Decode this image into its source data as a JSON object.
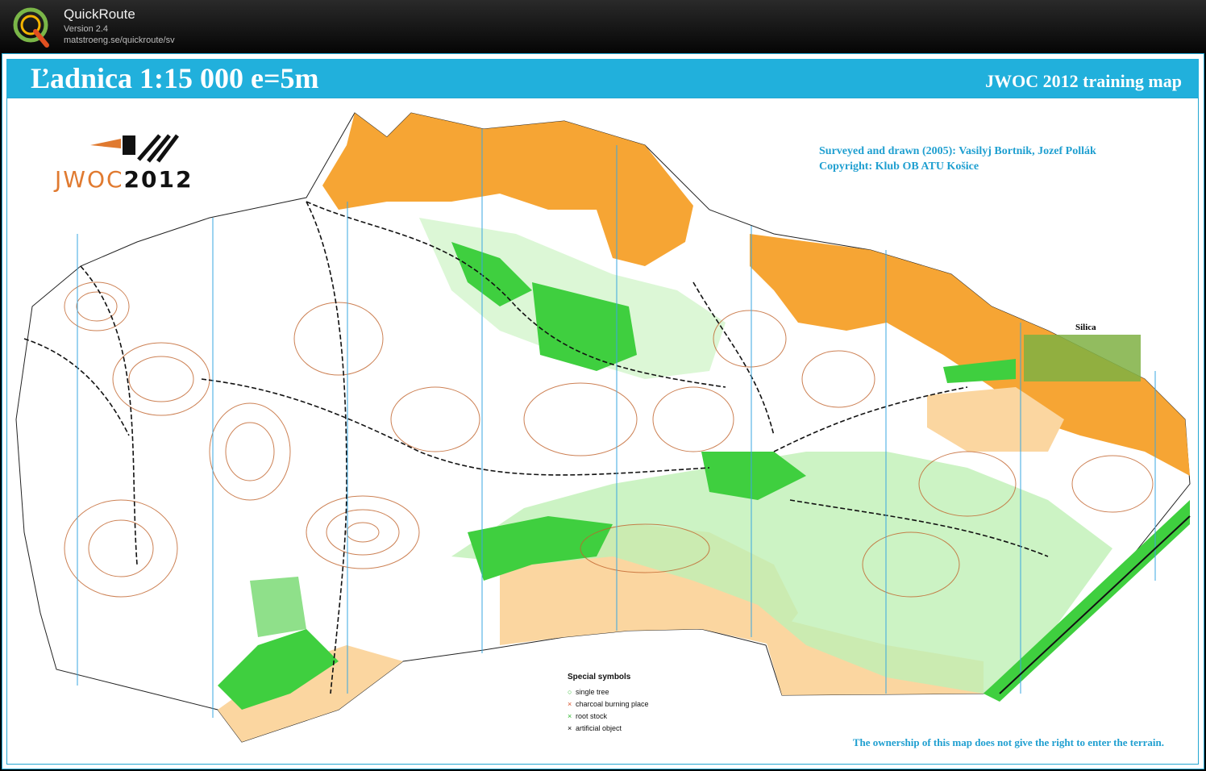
{
  "app": {
    "name": "QuickRoute",
    "version": "Version 2.4",
    "url": "matstroeng.se/quickroute/sv"
  },
  "map": {
    "title": "Ľadnica  1:15 000  e=5m",
    "banner_right": "JWOC 2012 training map",
    "credit_line1": "Surveyed and drawn (2005): Vasilyj Bortnik, Jozef Pollák",
    "credit_line2": "Copyright: Klub OB ATU Košice",
    "disclaimer": "The ownership of this map does not give the right to enter the terrain.",
    "logo_text_a": "JWOC",
    "logo_text_b": "2012",
    "place_label": "Silica",
    "legend": {
      "title": "Special symbols",
      "items": [
        {
          "label": "single tree",
          "icon": "green-circle-icon",
          "color": "#2eb82e"
        },
        {
          "label": "charcoal burning place",
          "icon": "red-x-icon",
          "color": "#d9532b"
        },
        {
          "label": "root stock",
          "icon": "green-x-icon",
          "color": "#2eb82e"
        },
        {
          "label": "artificial object",
          "icon": "black-x-icon",
          "color": "#000000"
        }
      ]
    }
  },
  "colors": {
    "banner": "#21b0dc",
    "open_land": "#f6a534",
    "rough_open": "#fbd6a0",
    "green": "#3fcf3f",
    "light_green": "#bff0b5",
    "contour": "#c0622a",
    "north_line": "#3aa7e0"
  }
}
